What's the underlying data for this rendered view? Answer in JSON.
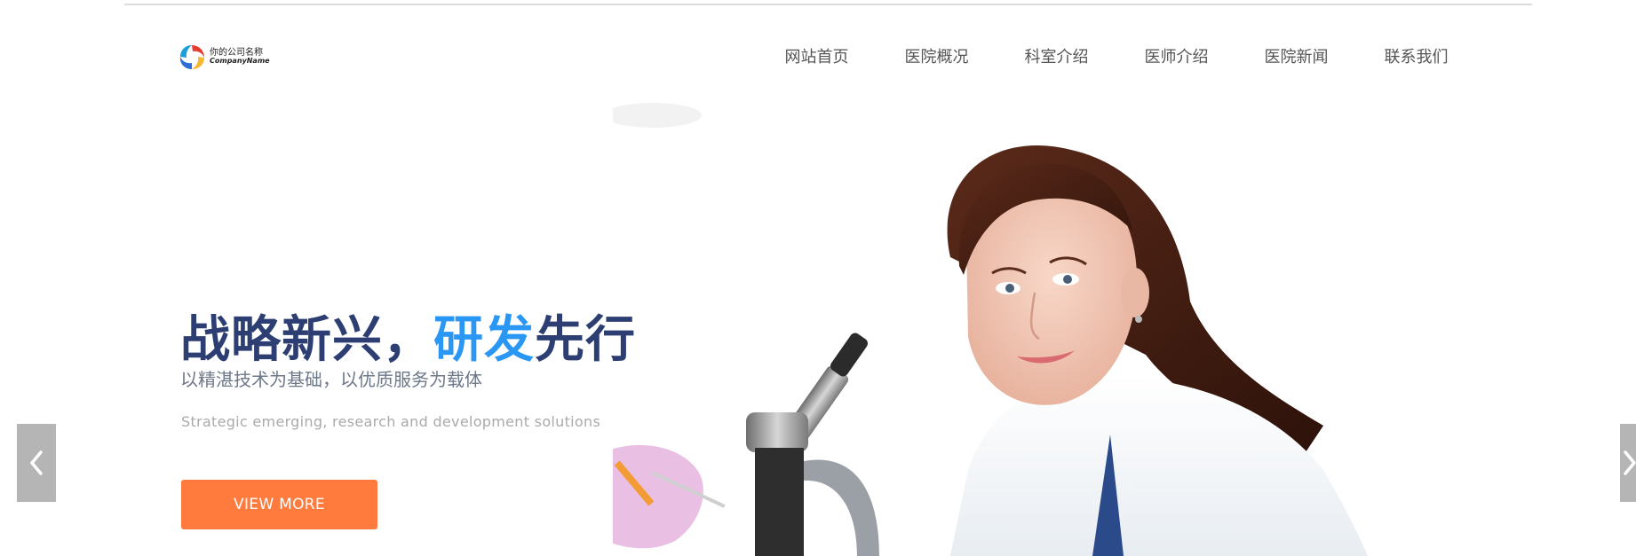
{
  "logo": {
    "name_cn": "你的公司名称",
    "name_en": "CompanyName"
  },
  "nav": {
    "items": [
      {
        "label": "网站首页"
      },
      {
        "label": "医院概况"
      },
      {
        "label": "科室介绍"
      },
      {
        "label": "医师介绍"
      },
      {
        "label": "医院新闻"
      },
      {
        "label": "联系我们"
      }
    ]
  },
  "hero": {
    "title_part1": "战略新兴，",
    "title_part2": "研发",
    "title_part3": "先行",
    "subtitle_cn": "以精湛技术为基础，以优质服务为载体",
    "subtitle_en": "Strategic emerging, research and development  solutions",
    "button_label": "VIEW MORE"
  },
  "slider": {
    "prev_icon": "chevron-left-icon",
    "next_icon": "chevron-right-icon"
  },
  "colors": {
    "title_dark": "#2d3e73",
    "title_blue": "#2b97f4",
    "button_bg": "#ff7a3d",
    "arrow_bg": "#b5b5b5"
  }
}
